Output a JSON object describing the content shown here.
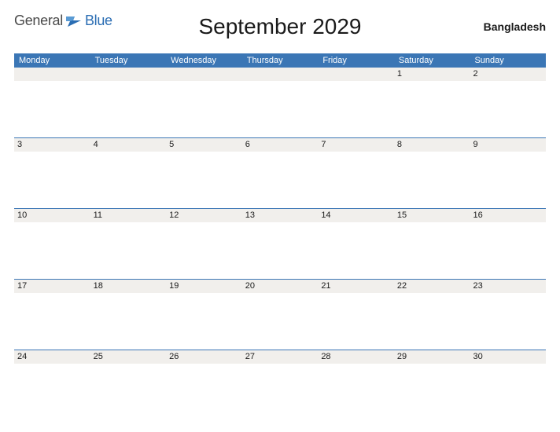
{
  "brand": {
    "part1": "General",
    "part2": "Blue"
  },
  "title": "September 2029",
  "country": "Bangladesh",
  "weekdays": [
    "Monday",
    "Tuesday",
    "Wednesday",
    "Thursday",
    "Friday",
    "Saturday",
    "Sunday"
  ],
  "weeks": [
    [
      "",
      "",
      "",
      "",
      "",
      "1",
      "2"
    ],
    [
      "3",
      "4",
      "5",
      "6",
      "7",
      "8",
      "9"
    ],
    [
      "10",
      "11",
      "12",
      "13",
      "14",
      "15",
      "16"
    ],
    [
      "17",
      "18",
      "19",
      "20",
      "21",
      "22",
      "23"
    ],
    [
      "24",
      "25",
      "26",
      "27",
      "28",
      "29",
      "30"
    ]
  ],
  "colors": {
    "headerBlue": "#3b76b5",
    "cellBg": "#f1efec"
  }
}
